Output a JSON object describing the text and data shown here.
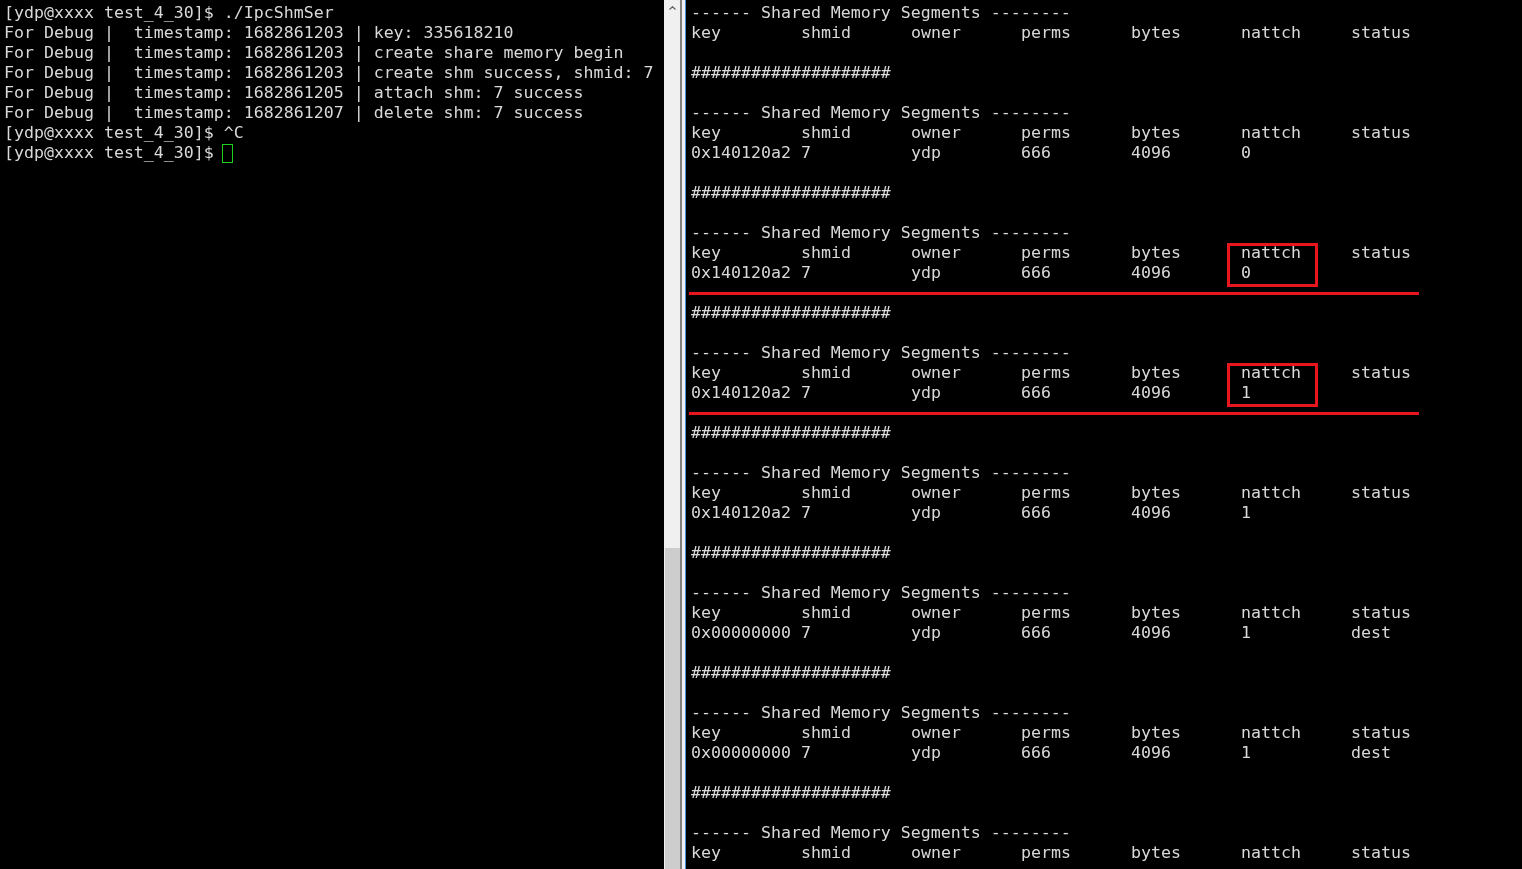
{
  "left_pane": {
    "lines": [
      {
        "text": "[ydp@xxxx test_4_30]$ ./IpcShmSer",
        "cursor": false
      },
      {
        "text": "For Debug |  timestamp: 1682861203 | key: 335618210",
        "cursor": false
      },
      {
        "text": "For Debug |  timestamp: 1682861203 | create share memory begin",
        "cursor": false
      },
      {
        "text": "For Debug |  timestamp: 1682861203 | create shm success, shmid: 7",
        "cursor": false
      },
      {
        "text": "For Debug |  timestamp: 1682861205 | attach shm: 7 success",
        "cursor": false
      },
      {
        "text": "For Debug |  timestamp: 1682861207 | delete shm: 7 success",
        "cursor": false
      },
      {
        "text": "[ydp@xxxx test_4_30]$ ^C",
        "cursor": false
      },
      {
        "text": "[ydp@xxxx test_4_30]$",
        "cursor": true
      }
    ]
  },
  "right_pane": {
    "entries": [
      {
        "kind": "segments",
        "title": "------ Shared Memory Segments --------",
        "columns": [
          {
            "label": "key",
            "boxed": false
          },
          {
            "label": "shmid",
            "boxed": false
          },
          {
            "label": "owner",
            "boxed": false
          },
          {
            "label": "perms",
            "boxed": false
          },
          {
            "label": "bytes",
            "boxed": false
          },
          {
            "label": "nattch",
            "boxed": false
          },
          {
            "label": "status",
            "boxed": false
          }
        ],
        "underlined": false
      },
      {
        "kind": "separator",
        "text": "####################"
      },
      {
        "kind": "segments",
        "title": "------ Shared Memory Segments --------",
        "columns": [
          {
            "label": "key",
            "boxed": false
          },
          {
            "label": "shmid",
            "boxed": false
          },
          {
            "label": "owner",
            "boxed": false
          },
          {
            "label": "perms",
            "boxed": false
          },
          {
            "label": "bytes",
            "boxed": false
          },
          {
            "label": "nattch",
            "boxed": false
          },
          {
            "label": "status",
            "boxed": false
          }
        ],
        "rows": [
          [
            "0x140120a2",
            "7",
            "ydp",
            "666",
            "4096",
            "0"
          ]
        ],
        "underlined": false
      },
      {
        "kind": "separator",
        "text": "####################"
      },
      {
        "kind": "segments",
        "title": "------ Shared Memory Segments --------",
        "columns": [
          {
            "label": "key",
            "boxed": false
          },
          {
            "label": "shmid",
            "boxed": false
          },
          {
            "label": "owner",
            "boxed": false
          },
          {
            "label": "perms",
            "boxed": false
          },
          {
            "label": "bytes",
            "boxed": false
          },
          {
            "label": "nattch",
            "boxed": true
          },
          {
            "label": "status",
            "boxed": false
          }
        ],
        "rows": [
          [
            "0x140120a2",
            "7",
            "ydp",
            "666",
            "4096",
            "0"
          ]
        ],
        "underlined": true
      },
      {
        "kind": "separator",
        "text": "####################"
      },
      {
        "kind": "segments",
        "title": "------ Shared Memory Segments --------",
        "columns": [
          {
            "label": "key",
            "boxed": false
          },
          {
            "label": "shmid",
            "boxed": false
          },
          {
            "label": "owner",
            "boxed": false
          },
          {
            "label": "perms",
            "boxed": false
          },
          {
            "label": "bytes",
            "boxed": false
          },
          {
            "label": "nattch",
            "boxed": true
          },
          {
            "label": "status",
            "boxed": false
          }
        ],
        "rows": [
          [
            "0x140120a2",
            "7",
            "ydp",
            "666",
            "4096",
            "1"
          ]
        ],
        "underlined": true
      },
      {
        "kind": "separator",
        "text": "####################"
      },
      {
        "kind": "segments",
        "title": "------ Shared Memory Segments --------",
        "columns": [
          {
            "label": "key",
            "boxed": false
          },
          {
            "label": "shmid",
            "boxed": false
          },
          {
            "label": "owner",
            "boxed": false
          },
          {
            "label": "perms",
            "boxed": false
          },
          {
            "label": "bytes",
            "boxed": false
          },
          {
            "label": "nattch",
            "boxed": false
          },
          {
            "label": "status",
            "boxed": false
          }
        ],
        "rows": [
          [
            "0x140120a2",
            "7",
            "ydp",
            "666",
            "4096",
            "1"
          ]
        ],
        "underlined": false
      },
      {
        "kind": "separator",
        "text": "####################"
      },
      {
        "kind": "segments",
        "title": "------ Shared Memory Segments --------",
        "columns": [
          {
            "label": "key",
            "boxed": false
          },
          {
            "label": "shmid",
            "boxed": false
          },
          {
            "label": "owner",
            "boxed": false
          },
          {
            "label": "perms",
            "boxed": false
          },
          {
            "label": "bytes",
            "boxed": false
          },
          {
            "label": "nattch",
            "boxed": false
          },
          {
            "label": "status",
            "boxed": false
          }
        ],
        "rows": [
          [
            "0x00000000",
            "7",
            "ydp",
            "666",
            "4096",
            "1",
            "dest"
          ]
        ],
        "underlined": false
      },
      {
        "kind": "separator",
        "text": "####################"
      },
      {
        "kind": "segments",
        "title": "------ Shared Memory Segments --------",
        "columns": [
          {
            "label": "key",
            "boxed": false
          },
          {
            "label": "shmid",
            "boxed": false
          },
          {
            "label": "owner",
            "boxed": false
          },
          {
            "label": "perms",
            "boxed": false
          },
          {
            "label": "bytes",
            "boxed": false
          },
          {
            "label": "nattch",
            "boxed": false
          },
          {
            "label": "status",
            "boxed": false
          }
        ],
        "rows": [
          [
            "0x00000000",
            "7",
            "ydp",
            "666",
            "4096",
            "1",
            "dest"
          ]
        ],
        "underlined": false
      },
      {
        "kind": "separator",
        "text": "####################"
      },
      {
        "kind": "segments",
        "title": "------ Shared Memory Segments --------",
        "columns": [
          {
            "label": "key",
            "boxed": false
          },
          {
            "label": "shmid",
            "boxed": false
          },
          {
            "label": "owner",
            "boxed": false
          },
          {
            "label": "perms",
            "boxed": false
          },
          {
            "label": "bytes",
            "boxed": false
          },
          {
            "label": "nattch",
            "boxed": false
          },
          {
            "label": "status",
            "boxed": false
          }
        ],
        "underlined": false
      }
    ]
  }
}
